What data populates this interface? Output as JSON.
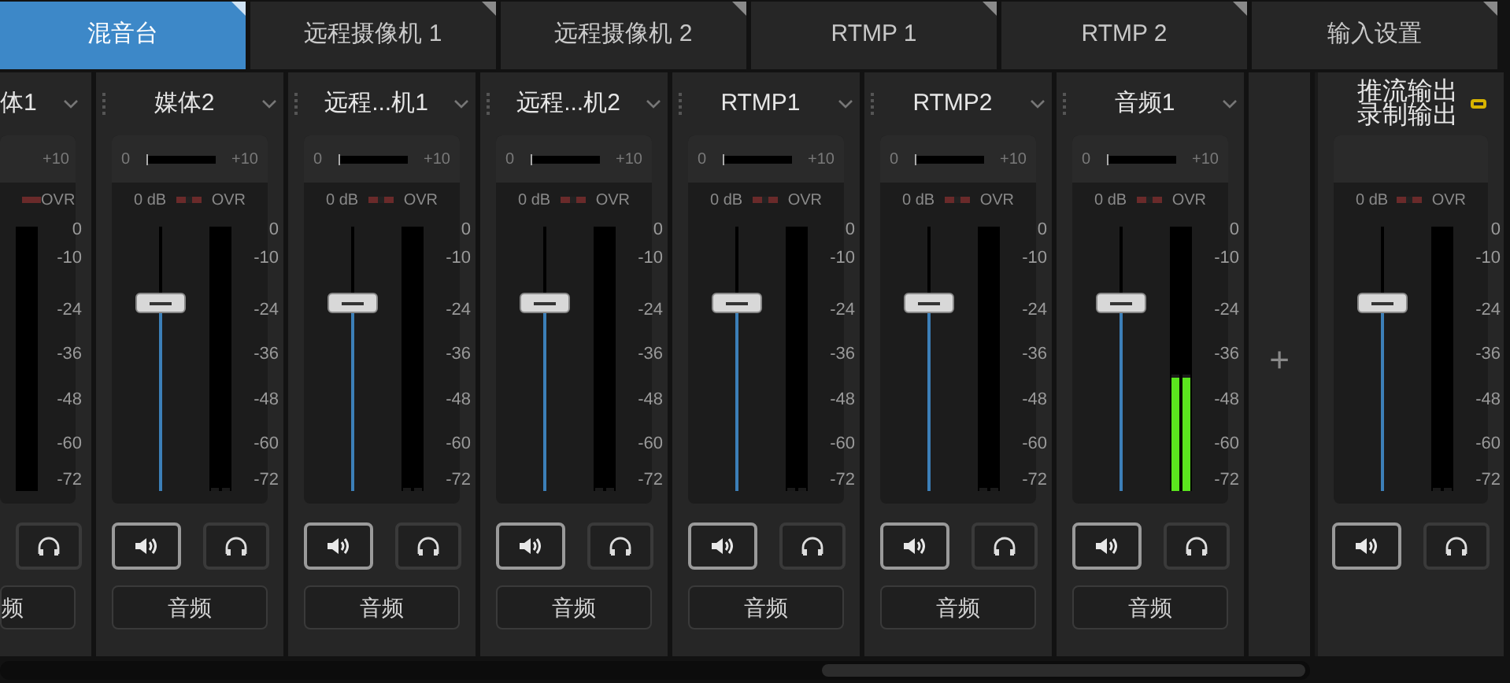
{
  "tabs": [
    {
      "label": "混音台",
      "selected": true
    },
    {
      "label": "远程摄像机 1",
      "selected": false
    },
    {
      "label": "远程摄像机 2",
      "selected": false
    },
    {
      "label": "RTMP 1",
      "selected": false
    },
    {
      "label": "RTMP 2",
      "selected": false
    },
    {
      "label": "输入设置",
      "selected": false
    }
  ],
  "channels": [
    {
      "kind": "partial",
      "name": "体1",
      "gain_max": "+10",
      "ovr": "OVR",
      "scale": [
        "0",
        "-10",
        "-24",
        "-36",
        "-48",
        "-60",
        "-72"
      ],
      "headphones": {
        "on": false
      },
      "button": "频"
    },
    {
      "kind": "full",
      "name": "媒体2",
      "gain_min": "0",
      "gain_max": "+10",
      "trim": {
        "level": 0.02
      },
      "db": "0 dB",
      "ovr": "OVR",
      "scale": [
        "0",
        "-10",
        "-24",
        "-36",
        "-48",
        "-60",
        "-72"
      ],
      "fader": {
        "level": 0.71
      },
      "meter": {
        "level": 0
      },
      "speaker": {
        "on": true
      },
      "headphones": {
        "on": false
      },
      "button": "音频"
    },
    {
      "kind": "full",
      "name": "远程...机1",
      "gain_min": "0",
      "gain_max": "+10",
      "trim": {
        "level": 0.02
      },
      "db": "0 dB",
      "ovr": "OVR",
      "scale": [
        "0",
        "-10",
        "-24",
        "-36",
        "-48",
        "-60",
        "-72"
      ],
      "fader": {
        "level": 0.71
      },
      "meter": {
        "level": 0
      },
      "speaker": {
        "on": true
      },
      "headphones": {
        "on": false
      },
      "button": "音频"
    },
    {
      "kind": "full",
      "name": "远程...机2",
      "gain_min": "0",
      "gain_max": "+10",
      "trim": {
        "level": 0.02
      },
      "db": "0 dB",
      "ovr": "OVR",
      "scale": [
        "0",
        "-10",
        "-24",
        "-36",
        "-48",
        "-60",
        "-72"
      ],
      "fader": {
        "level": 0.71
      },
      "meter": {
        "level": 0
      },
      "speaker": {
        "on": true
      },
      "headphones": {
        "on": false
      },
      "button": "音频"
    },
    {
      "kind": "full",
      "name": "RTMP1",
      "gain_min": "0",
      "gain_max": "+10",
      "trim": {
        "level": 0.02
      },
      "db": "0 dB",
      "ovr": "OVR",
      "scale": [
        "0",
        "-10",
        "-24",
        "-36",
        "-48",
        "-60",
        "-72"
      ],
      "fader": {
        "level": 0.71
      },
      "meter": {
        "level": 0
      },
      "speaker": {
        "on": true
      },
      "headphones": {
        "on": false
      },
      "button": "音频"
    },
    {
      "kind": "full",
      "name": "RTMP2",
      "gain_min": "0",
      "gain_max": "+10",
      "trim": {
        "level": 0.02
      },
      "db": "0 dB",
      "ovr": "OVR",
      "scale": [
        "0",
        "-10",
        "-24",
        "-36",
        "-48",
        "-60",
        "-72"
      ],
      "fader": {
        "level": 0.71
      },
      "meter": {
        "level": 0
      },
      "speaker": {
        "on": true
      },
      "headphones": {
        "on": false
      },
      "button": "音频"
    },
    {
      "kind": "full",
      "name": "音频1",
      "gain_min": "0",
      "gain_max": "+10",
      "trim": {
        "level": 0.02
      },
      "db": "0 dB",
      "ovr": "OVR",
      "scale": [
        "0",
        "-10",
        "-24",
        "-36",
        "-48",
        "-60",
        "-72"
      ],
      "fader": {
        "level": 0.71
      },
      "meter": {
        "level": 0.44
      },
      "speaker": {
        "on": true
      },
      "headphones": {
        "on": false
      },
      "button": "音频"
    }
  ],
  "add_button": "+",
  "master": {
    "names": [
      "推流输出",
      "录制输出"
    ],
    "db": "0 dB",
    "ovr": "OVR",
    "scale": [
      "0",
      "-10",
      "-24",
      "-36",
      "-48",
      "-60",
      "-72"
    ],
    "fader": {
      "level": 0.71
    },
    "meter": {
      "level": 0
    },
    "speaker": {
      "on": true
    },
    "headphones": {
      "on": false
    }
  }
}
